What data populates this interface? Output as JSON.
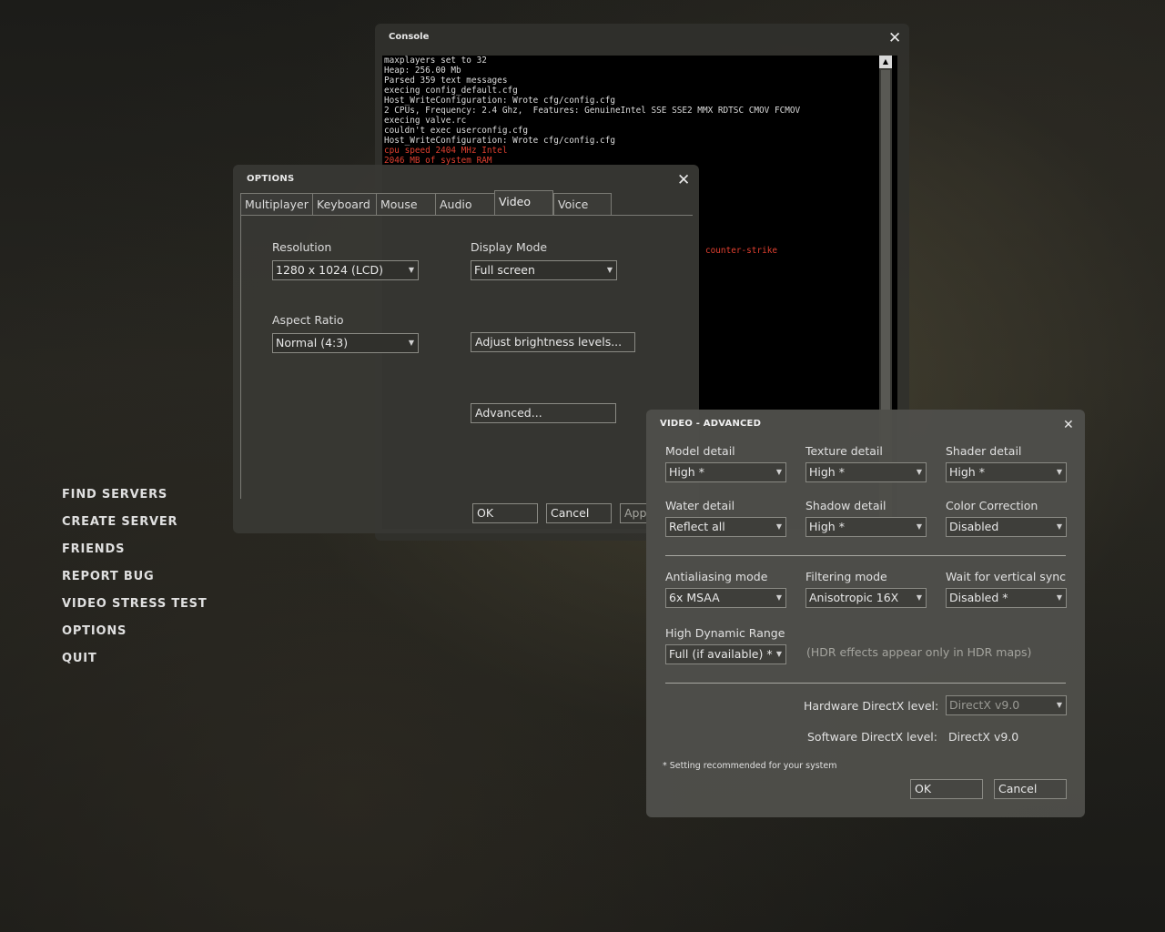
{
  "main_menu": {
    "items": [
      "FIND SERVERS",
      "CREATE SERVER",
      "FRIENDS",
      "REPORT BUG",
      "VIDEO STRESS TEST",
      "OPTIONS",
      "QUIT"
    ]
  },
  "console": {
    "title": "Console",
    "lines": [
      {
        "text": "maxplayers set to 32",
        "color": "normal"
      },
      {
        "text": "Heap: 256.00 Mb",
        "color": "normal"
      },
      {
        "text": "Parsed 359 text messages",
        "color": "normal"
      },
      {
        "text": "execing config_default.cfg",
        "color": "normal"
      },
      {
        "text": "Host_WriteConfiguration: Wrote cfg/config.cfg",
        "color": "normal"
      },
      {
        "text": "2 CPUs, Frequency: 2.4 Ghz,  Features: GenuineIntel SSE SSE2 MMX RDTSC CMOV FCMOV",
        "color": "normal"
      },
      {
        "text": "execing valve.rc",
        "color": "normal"
      },
      {
        "text": "couldn't exec userconfig.cfg",
        "color": "normal"
      },
      {
        "text": "Host_WriteConfiguration: Wrote cfg/config.cfg",
        "color": "normal"
      },
      {
        "text": "cpu speed 2404 MHz Intel",
        "color": "red"
      },
      {
        "text": "2046 MB of system RAM",
        "color": "red"
      }
    ],
    "tail_fragment": "counter-strike",
    "colors": {
      "normal": "#dcdcdc",
      "red": "#e04030"
    }
  },
  "options": {
    "title": "OPTIONS",
    "tabs": [
      "Multiplayer",
      "Keyboard",
      "Mouse",
      "Audio",
      "Video",
      "Voice"
    ],
    "active_tab": "Video",
    "resolution_label": "Resolution",
    "resolution_value": "1280 x 1024 (LCD)",
    "display_mode_label": "Display Mode",
    "display_mode_value": "Full screen",
    "aspect_ratio_label": "Aspect Ratio",
    "aspect_ratio_value": "Normal (4:3)",
    "brightness_button": "Adjust brightness levels...",
    "advanced_button": "Advanced...",
    "ok_button": "OK",
    "cancel_button": "Cancel",
    "apply_button": "App"
  },
  "video_advanced": {
    "title": "VIDEO - ADVANCED",
    "model_detail": {
      "label": "Model detail",
      "value": "High *"
    },
    "texture_detail": {
      "label": "Texture detail",
      "value": "High *"
    },
    "shader_detail": {
      "label": "Shader detail",
      "value": "High *"
    },
    "water_detail": {
      "label": "Water detail",
      "value": "Reflect all"
    },
    "shadow_detail": {
      "label": "Shadow detail",
      "value": "High *"
    },
    "color_correction": {
      "label": "Color Correction",
      "value": "Disabled"
    },
    "antialiasing": {
      "label": "Antialiasing mode",
      "value": "6x MSAA"
    },
    "filtering": {
      "label": "Filtering mode",
      "value": "Anisotropic 16X"
    },
    "vsync": {
      "label": "Wait for vertical sync",
      "value": "Disabled *"
    },
    "hdr": {
      "label": "High Dynamic Range",
      "value": "Full (if available) *",
      "note": "(HDR effects appear only in HDR maps)"
    },
    "hardware_dx": {
      "label": "Hardware DirectX level:",
      "value": "DirectX v9.0"
    },
    "software_dx": {
      "label": "Software DirectX level:",
      "value": "DirectX v9.0"
    },
    "footnote": "* Setting recommended for your system",
    "ok_button": "OK",
    "cancel_button": "Cancel"
  },
  "icons": {
    "close": "close-icon",
    "dropdown": "chevron-down-icon",
    "scroll_up": "arrow-up-icon"
  }
}
